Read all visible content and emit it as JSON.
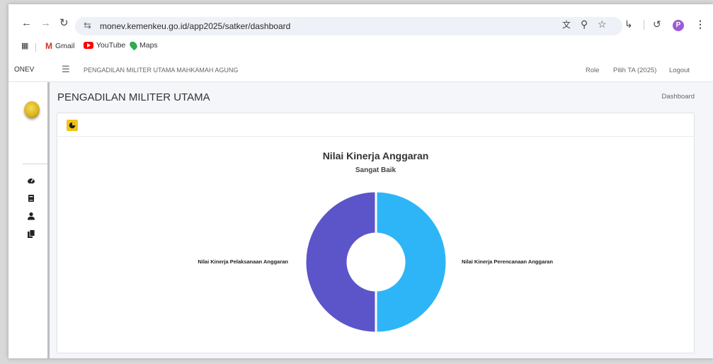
{
  "browser": {
    "url": "monev.kemenkeu.go.id/app2025/satker/dashboard",
    "profile_initial": "P",
    "bookmarks": [
      {
        "label": "Gmail"
      },
      {
        "label": "YouTube"
      },
      {
        "label": "Maps"
      }
    ]
  },
  "app": {
    "brand": "ONEV",
    "header_org": "PENGADILAN MILITER UTAMA MAHKAMAH AGUNG",
    "header_links": {
      "role": "Role",
      "pilih_ta": "Pilih TA (2025)",
      "logout": "Logout"
    },
    "page_title": "PENGADILAN MILITER UTAMA",
    "breadcrumb": "Dashboard",
    "sidebar_icons": [
      "dashboard-icon",
      "book-icon",
      "user-icon",
      "documents-icon"
    ]
  },
  "chart_data": {
    "type": "pie",
    "title": "Nilai Kinerja Anggaran",
    "subtitle": "Sangat Baik",
    "series": [
      {
        "name": "Nilai Kinerja Perencanaan Anggaran",
        "value": 50,
        "color": "#2eb5f7"
      },
      {
        "name": "Nilai Kinerja Pelaksanaan Anggaran",
        "value": 50,
        "color": "#5b55c9"
      }
    ]
  }
}
